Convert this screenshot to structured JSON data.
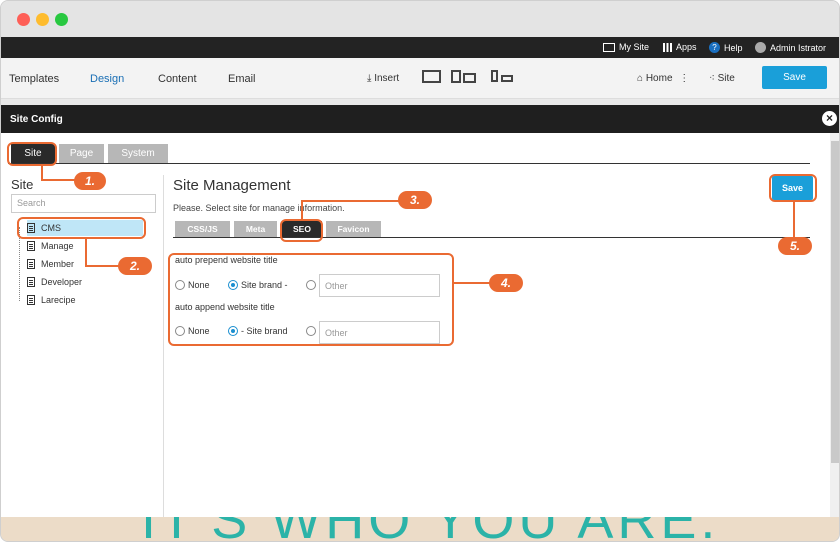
{
  "topbar": {
    "my_site": "My Site",
    "apps": "Apps",
    "help": "Help",
    "user": "Admin Istrator"
  },
  "menubar": {
    "templates": "Templates",
    "design": "Design",
    "content": "Content",
    "email": "Email",
    "insert": "Insert",
    "home": "Home",
    "site": "Site",
    "save": "Save"
  },
  "modal": {
    "title": "Site Config",
    "tabs": [
      "Site",
      "Page",
      "System"
    ],
    "sidebar": {
      "title": "Site",
      "search_placeholder": "Search",
      "items": [
        "CMS",
        "Manage",
        "Member",
        "Developer",
        "Larecipe"
      ]
    },
    "main": {
      "title": "Site Management",
      "subtitle": "Please. Select site for manage information.",
      "tabs": [
        "CSS/JS",
        "Meta",
        "SEO",
        "Favicon"
      ],
      "save": "Save",
      "prepend": {
        "label": "auto prepend website title",
        "options": [
          "None",
          "Site brand -"
        ],
        "other_placeholder": "Other",
        "selected": "Site brand -"
      },
      "append": {
        "label": "auto append website title",
        "options": [
          "None",
          "- Site brand"
        ],
        "other_placeholder": "Other",
        "selected": "- Site brand"
      }
    }
  },
  "callouts": [
    "1.",
    "2.",
    "3.",
    "4.",
    "5."
  ],
  "background_text": "IT'S WHO YOU ARE.",
  "colors": {
    "accent": "#1a9fd9",
    "callout": "#ea6a32",
    "dark": "#232323"
  }
}
